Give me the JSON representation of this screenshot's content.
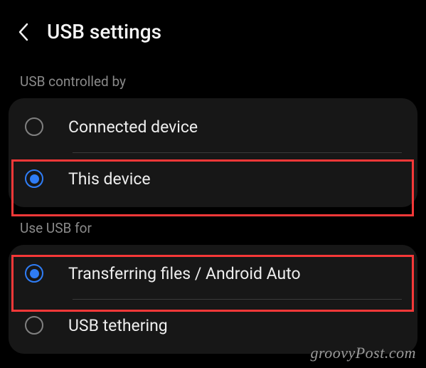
{
  "header": {
    "title": "USB settings"
  },
  "section1": {
    "label": "USB controlled by",
    "option1": {
      "label": "Connected device",
      "selected": false
    },
    "option2": {
      "label": "This device",
      "selected": true
    }
  },
  "section2": {
    "label": "Use USB for",
    "option1": {
      "label": "Transferring files / Android Auto",
      "selected": true
    },
    "option2": {
      "label": "USB tethering",
      "selected": false
    }
  },
  "watermark": "groovyPost.com"
}
